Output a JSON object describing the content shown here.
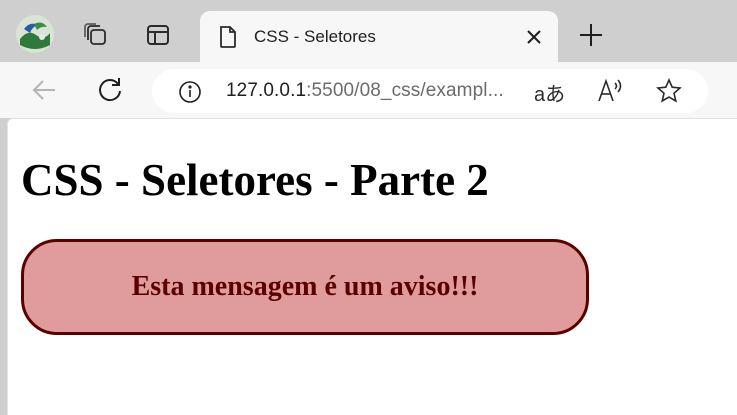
{
  "tab": {
    "title": "CSS - Seletores"
  },
  "address_bar": {
    "url_host": "127.0.0.1",
    "url_rest": ":5500/08_css/exampl..."
  },
  "toolbar": {
    "read_aloud_glyph": "A",
    "translate_glyph": "aあ"
  },
  "page": {
    "heading": "CSS - Seletores - Parte 2",
    "warning_message": "Esta mensagem é um aviso!!!"
  },
  "colors": {
    "warning_bg": "#e09c9c",
    "warning_border": "#5a0000",
    "warning_text": "#5a0000"
  }
}
